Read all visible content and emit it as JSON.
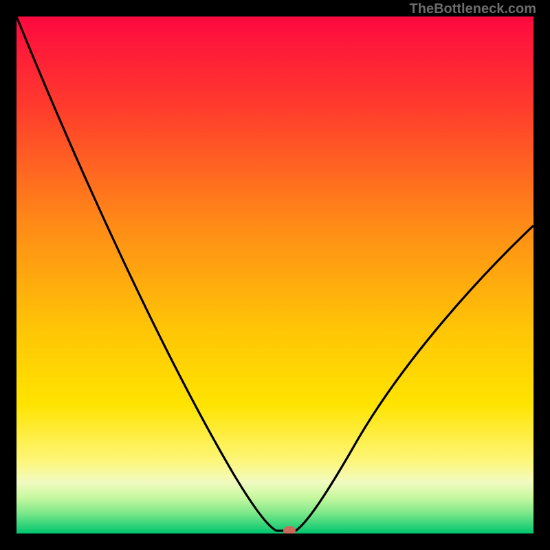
{
  "attribution": "TheBottleneck.com",
  "chart_data": {
    "type": "line",
    "title": "",
    "xlabel": "",
    "ylabel": "",
    "xlim": [
      0,
      100
    ],
    "ylim": [
      0,
      100
    ],
    "x": [
      0,
      5,
      10,
      15,
      20,
      25,
      30,
      35,
      40,
      45,
      48,
      50,
      52,
      55,
      60,
      65,
      70,
      75,
      80,
      85,
      90,
      95,
      100
    ],
    "values": [
      100,
      88,
      77,
      67,
      57,
      48,
      39,
      31,
      23,
      14,
      6,
      0,
      0,
      6,
      15,
      23,
      30,
      36,
      42,
      47,
      52,
      56,
      60
    ],
    "marker": {
      "x": 52,
      "y": 0,
      "color": "#c96a5d"
    },
    "background": "vertical-gradient-red-yellow-green",
    "grid": false
  },
  "colors": {
    "grad_top": "#fe093f",
    "grad_mid": "#fee300",
    "grad_green_light": "#b1f77c",
    "grad_green_dark": "#00c76f",
    "curve": "#000000",
    "border": "#000000",
    "marker": "#c96a5d"
  }
}
